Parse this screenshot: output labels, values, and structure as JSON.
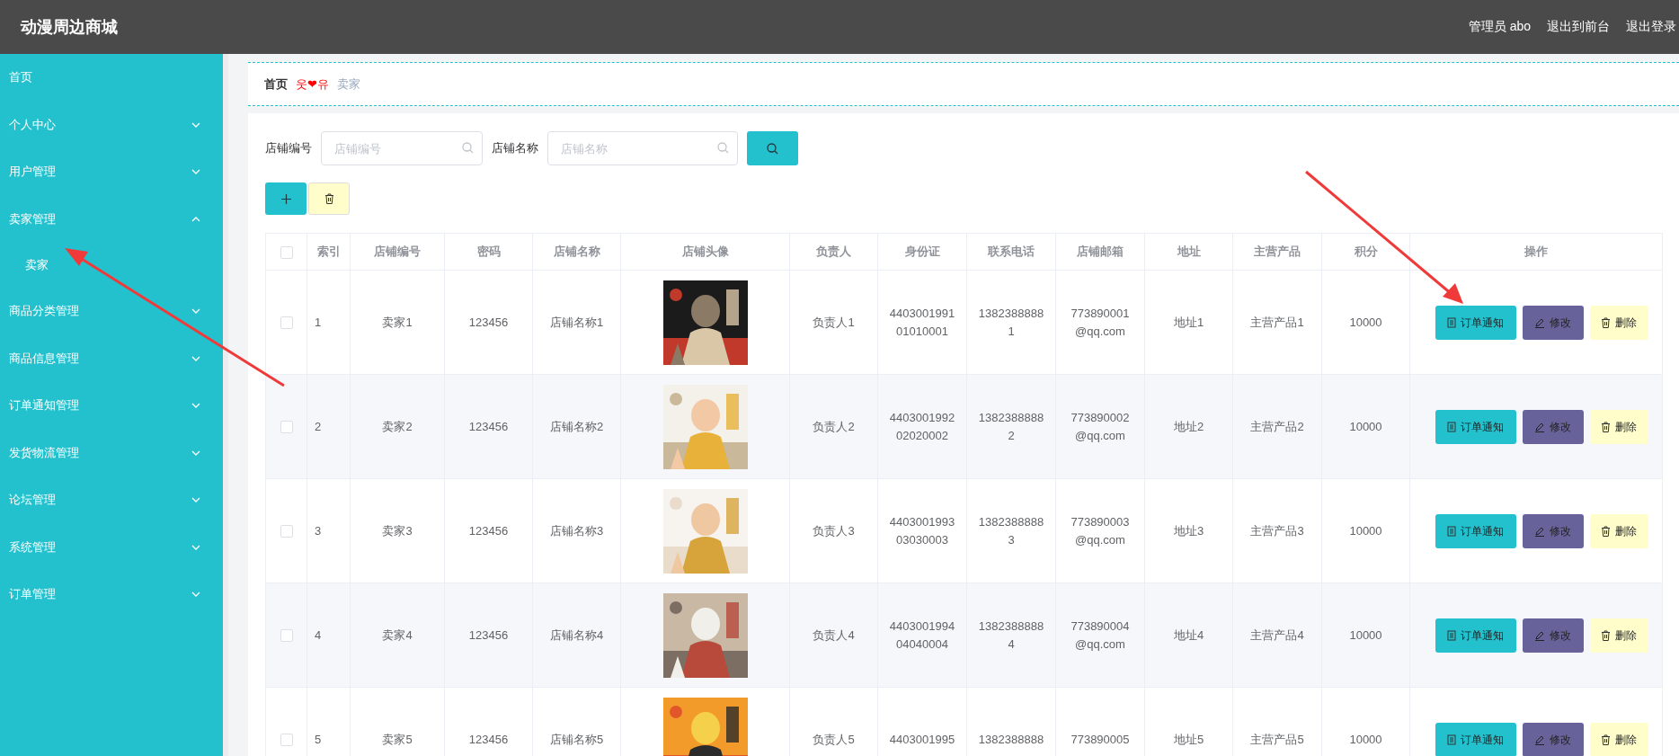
{
  "header": {
    "title": "动漫周边商城",
    "links": [
      "管理员 abo",
      "退出到前台",
      "退出登录"
    ]
  },
  "sidebar": {
    "items": [
      {
        "label": "首页",
        "kind": "link"
      },
      {
        "label": "个人中心",
        "kind": "menu",
        "expanded": false
      },
      {
        "label": "用户管理",
        "kind": "menu",
        "expanded": false
      },
      {
        "label": "卖家管理",
        "kind": "menu",
        "expanded": true,
        "children": [
          {
            "label": "卖家"
          }
        ]
      },
      {
        "label": "商品分类管理",
        "kind": "menu",
        "expanded": false
      },
      {
        "label": "商品信息管理",
        "kind": "menu",
        "expanded": false
      },
      {
        "label": "订单通知管理",
        "kind": "menu",
        "expanded": false
      },
      {
        "label": "发货物流管理",
        "kind": "menu",
        "expanded": false
      },
      {
        "label": "论坛管理",
        "kind": "menu",
        "expanded": false
      },
      {
        "label": "系统管理",
        "kind": "menu",
        "expanded": false
      },
      {
        "label": "订单管理",
        "kind": "menu",
        "expanded": false
      }
    ]
  },
  "breadcrumb": {
    "items": [
      "首页",
      "卖家"
    ],
    "separator": "웃❤유"
  },
  "search": {
    "fields": [
      {
        "label": "店铺编号",
        "placeholder": "店铺编号"
      },
      {
        "label": "店铺名称",
        "placeholder": "店铺名称"
      }
    ]
  },
  "table": {
    "header_checked": false,
    "columns": [
      "索引",
      "店铺编号",
      "密码",
      "店铺名称",
      "店铺头像",
      "负责人",
      "身份证",
      "联系电话",
      "店铺邮箱",
      "地址",
      "主营产品",
      "积分",
      "操作"
    ],
    "rows": [
      {
        "checked": false,
        "index": "1",
        "shop_no": "卖家1",
        "password": "123456",
        "shop_name": "店铺名称1",
        "manager": "负责人1",
        "id_card": "440300199101010001",
        "phone": "13823888881",
        "email": "773890001@qq.com",
        "address": "地址1",
        "product": "主营产品1",
        "points": "10000",
        "actions": [
          {
            "label": "订单通知",
            "kind": "notify"
          },
          {
            "label": "修改",
            "kind": "edit"
          },
          {
            "label": "删除",
            "kind": "delete"
          }
        ]
      },
      {
        "checked": false,
        "index": "2",
        "shop_no": "卖家2",
        "password": "123456",
        "shop_name": "店铺名称2",
        "manager": "负责人2",
        "id_card": "440300199202020002",
        "phone": "13823888882",
        "email": "773890002@qq.com",
        "address": "地址2",
        "product": "主营产品2",
        "points": "10000",
        "actions": [
          {
            "label": "订单通知",
            "kind": "notify"
          },
          {
            "label": "修改",
            "kind": "edit"
          },
          {
            "label": "删除",
            "kind": "delete"
          }
        ]
      },
      {
        "checked": false,
        "index": "3",
        "shop_no": "卖家3",
        "password": "123456",
        "shop_name": "店铺名称3",
        "manager": "负责人3",
        "id_card": "440300199303030003",
        "phone": "13823888883",
        "email": "773890003@qq.com",
        "address": "地址3",
        "product": "主营产品3",
        "points": "10000",
        "actions": [
          {
            "label": "订单通知",
            "kind": "notify"
          },
          {
            "label": "修改",
            "kind": "edit"
          },
          {
            "label": "删除",
            "kind": "delete"
          }
        ]
      },
      {
        "checked": false,
        "index": "4",
        "shop_no": "卖家4",
        "password": "123456",
        "shop_name": "店铺名称4",
        "manager": "负责人4",
        "id_card": "440300199404040004",
        "phone": "13823888884",
        "email": "773890004@qq.com",
        "address": "地址4",
        "product": "主营产品4",
        "points": "10000",
        "actions": [
          {
            "label": "订单通知",
            "kind": "notify"
          },
          {
            "label": "修改",
            "kind": "edit"
          },
          {
            "label": "删除",
            "kind": "delete"
          }
        ]
      },
      {
        "checked": false,
        "index": "5",
        "shop_no": "卖家5",
        "password": "123456",
        "shop_name": "店铺名称5",
        "manager": "负责人5",
        "id_card": "4403001995",
        "phone": "1382388888",
        "email": "773890005",
        "address": "地址5",
        "product": "主营产品5",
        "points": "10000",
        "actions": [
          {
            "label": "订单通知",
            "kind": "notify"
          },
          {
            "label": "修改",
            "kind": "edit"
          },
          {
            "label": "删除",
            "kind": "delete"
          }
        ]
      }
    ]
  }
}
